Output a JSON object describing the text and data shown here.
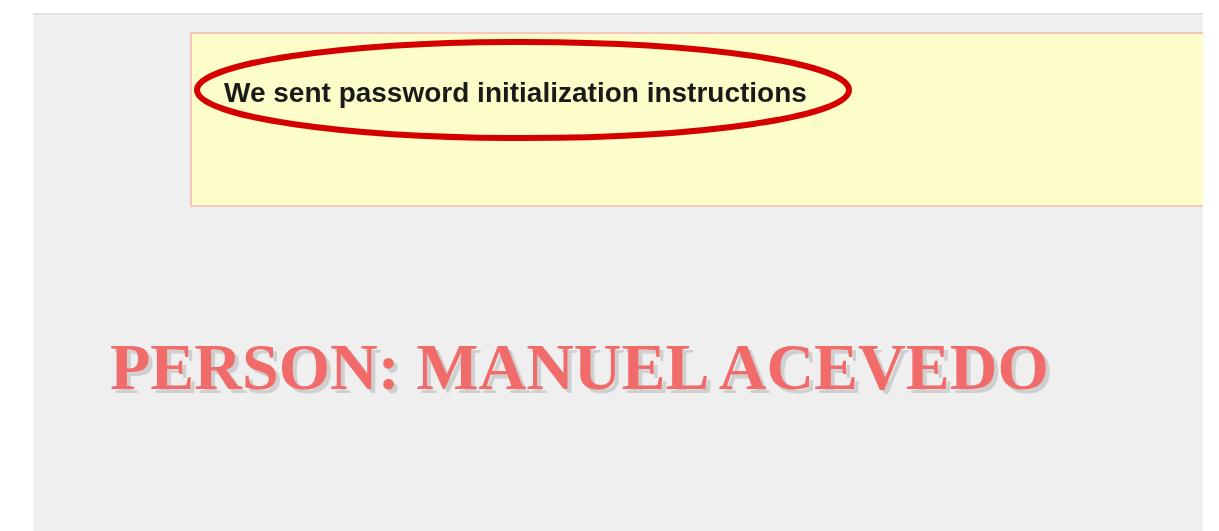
{
  "notice": {
    "message": "We sent password initialization instructions",
    "annotation": {
      "kind": "ellipse"
    }
  },
  "heading": "PERSON: MANUEL ACEVEDO"
}
